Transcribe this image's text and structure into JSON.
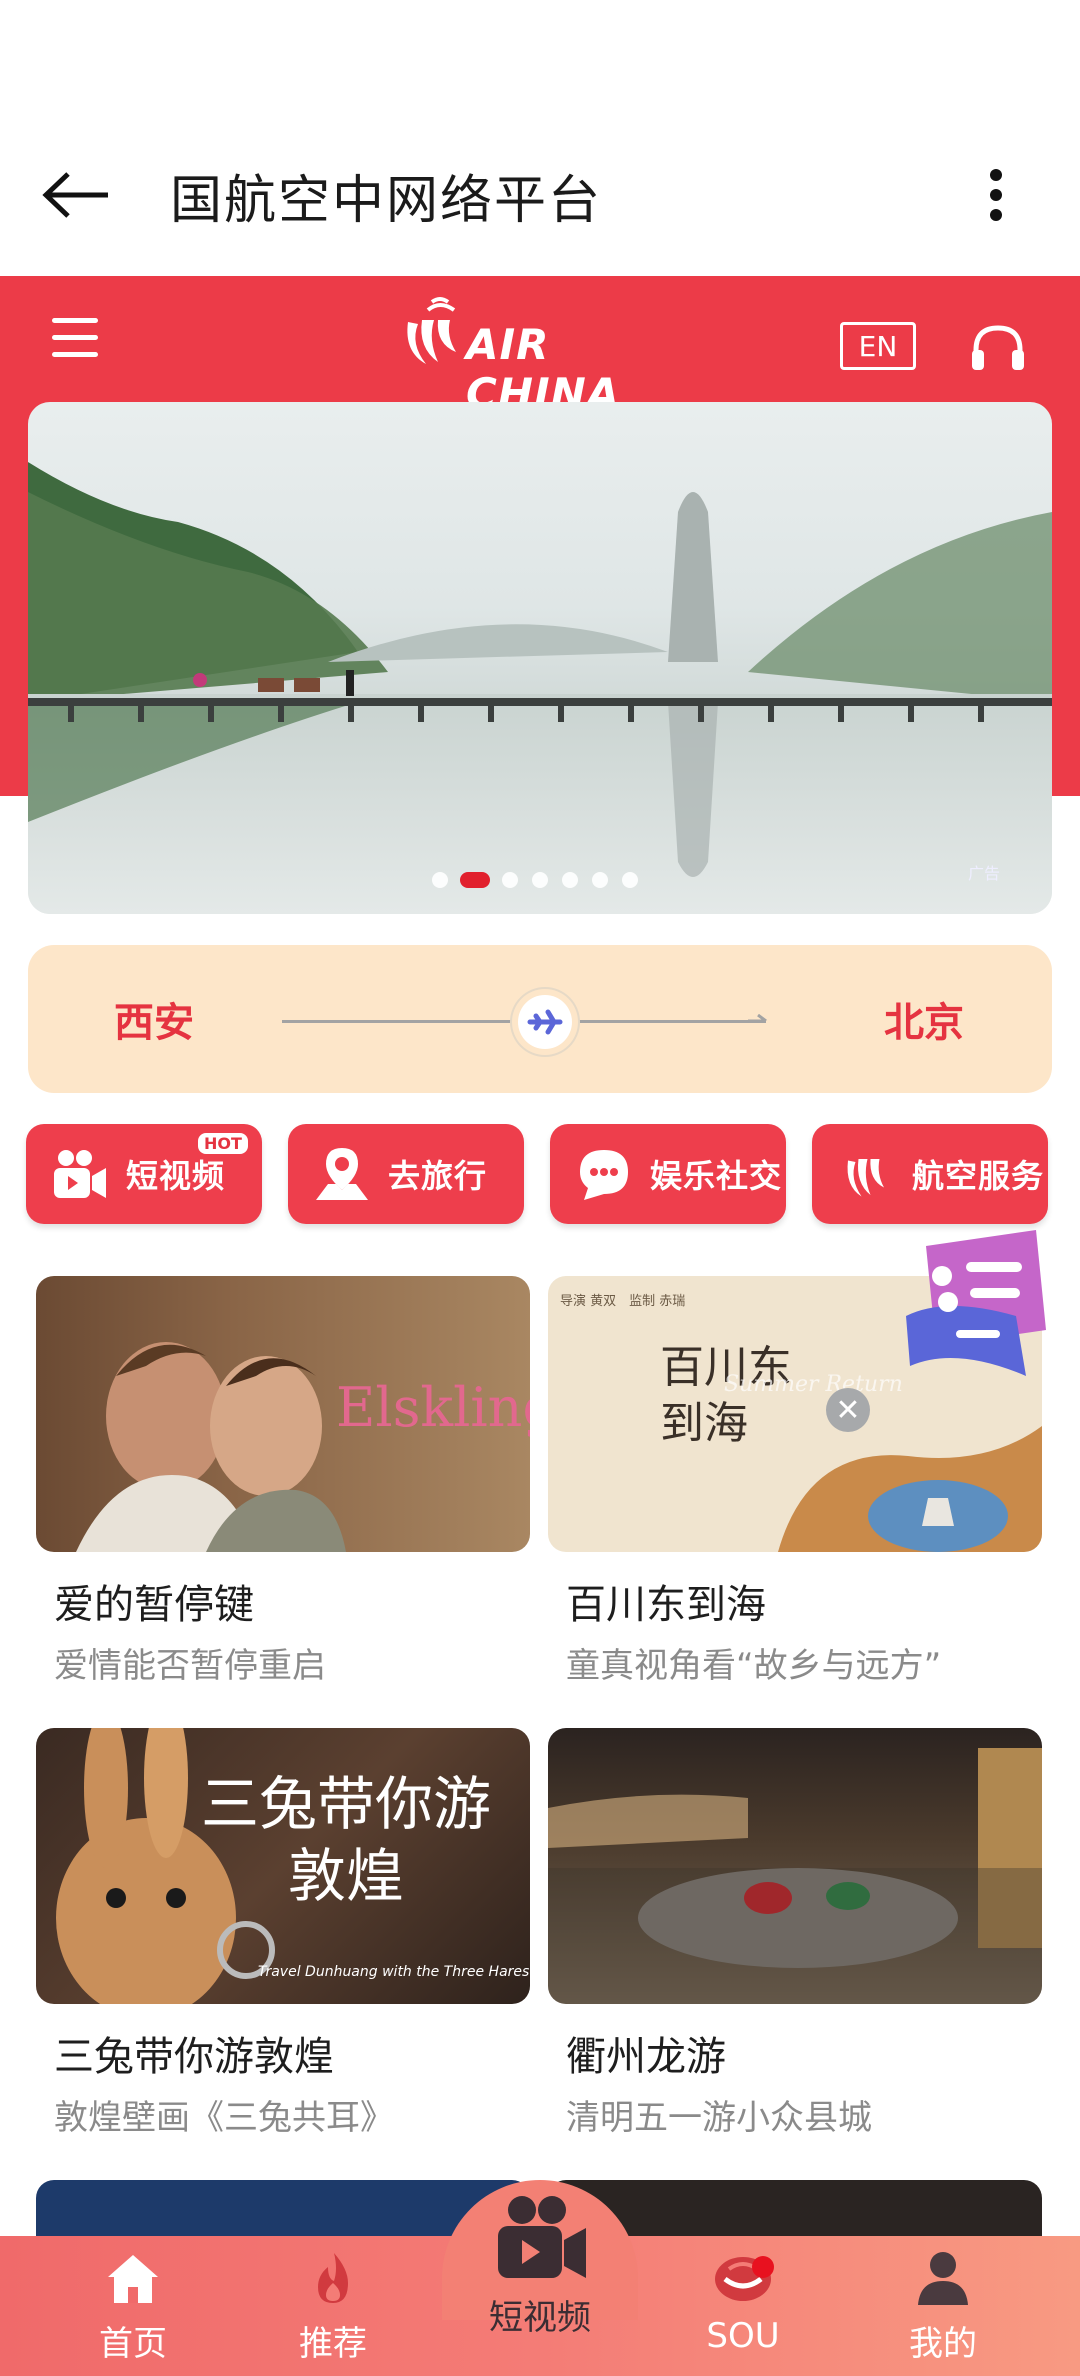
{
  "app_bar": {
    "title": "国航空中网络平台"
  },
  "header": {
    "logo_text": "AIR CHINA",
    "lang_label": "EN"
  },
  "banner": {
    "ad_label": "广告",
    "page_count": 7,
    "active_page": 2
  },
  "route": {
    "from": "西安",
    "to": "北京"
  },
  "quick_actions": [
    {
      "label": "短视频",
      "icon": "video-camera-icon",
      "badge": "HOT"
    },
    {
      "label": "去旅行",
      "icon": "location-pin-icon"
    },
    {
      "label": "娱乐社交",
      "icon": "chat-bubble-icon"
    },
    {
      "label": "航空服务",
      "icon": "air-china-logo-icon"
    }
  ],
  "cards": [
    {
      "title": "爱的暂停键",
      "subtitle": "爱情能否暂停重启",
      "thumb_text": "Elskling"
    },
    {
      "title": "百川东到海",
      "subtitle": "童真视角看“故乡与远方”",
      "thumb_text": "百川东到海",
      "thumb_small_left": "导演 黄双　监制 赤瑞",
      "thumb_small_right": "Summer Return"
    },
    {
      "title": "三兔带你游敦煌",
      "subtitle": "敦煌壁画《三兔共耳》",
      "thumb_text": "三兔带你游敦煌",
      "thumb_caption": "Travel Dunhuang with the Three Hares"
    },
    {
      "title": "衢州龙游",
      "subtitle": "清明五一游小众县城"
    }
  ],
  "bottom_nav": [
    {
      "label": "首页",
      "icon": "home-icon"
    },
    {
      "label": "推荐",
      "icon": "flame-icon"
    },
    {
      "label": "短视频",
      "icon": "video-camera-icon"
    },
    {
      "label": "SOU",
      "icon": "sou-icon"
    },
    {
      "label": "我的",
      "icon": "user-icon"
    }
  ],
  "colors": {
    "brand_red": "#ec3b48",
    "route_bg": "#fde6c9"
  }
}
